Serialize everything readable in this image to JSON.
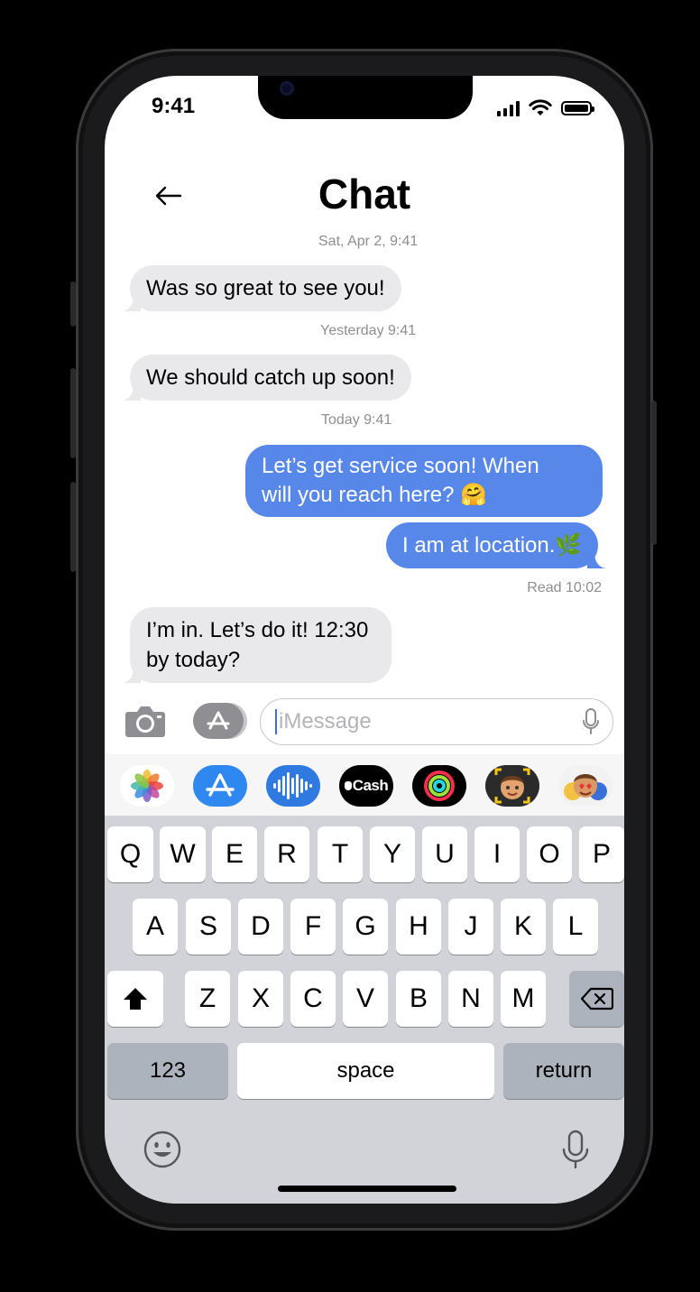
{
  "status_bar": {
    "time": "9:41"
  },
  "header": {
    "title": "Chat"
  },
  "messages": [
    {
      "timestamp": "Sat, Apr 2, 9:41",
      "direction": "incoming",
      "text": "Was so great to see you!"
    },
    {
      "timestamp": "Yesterday 9:41",
      "direction": "incoming",
      "text": "We should catch up soon!"
    },
    {
      "timestamp": "Today 9:41",
      "direction": "outgoing",
      "lines": [
        "Let’s get service soon! When",
        "will you reach here? 🤗"
      ]
    },
    {
      "direction": "outgoing",
      "text": "I am at location.🌿"
    },
    {
      "direction": "incoming",
      "lines": [
        "I’m in. Let’s do it! 12:30",
        "by today?"
      ]
    }
  ],
  "read_receipt": "Read 10:02",
  "compose": {
    "placeholder": "iMessage"
  },
  "app_strip": {
    "apps": [
      "photos-icon",
      "app-store-icon",
      "audio-message-icon",
      "apple-cash-icon",
      "activity-icon",
      "memoji-icon",
      "memoji-stickers-icon"
    ],
    "cash_label": "Cash"
  },
  "keyboard": {
    "row1": [
      "Q",
      "W",
      "E",
      "R",
      "T",
      "Y",
      "U",
      "I",
      "O",
      "P"
    ],
    "row2": [
      "A",
      "S",
      "D",
      "F",
      "G",
      "H",
      "J",
      "K",
      "L"
    ],
    "row3": [
      "Z",
      "X",
      "C",
      "V",
      "B",
      "N",
      "M"
    ],
    "numbers_label": "123",
    "space_label": "space",
    "return_label": "return"
  },
  "colors": {
    "outgoing_bubble": "#5788e9",
    "incoming_bubble": "#e9e9eb",
    "keyboard_bg": "#d1d3d9"
  }
}
